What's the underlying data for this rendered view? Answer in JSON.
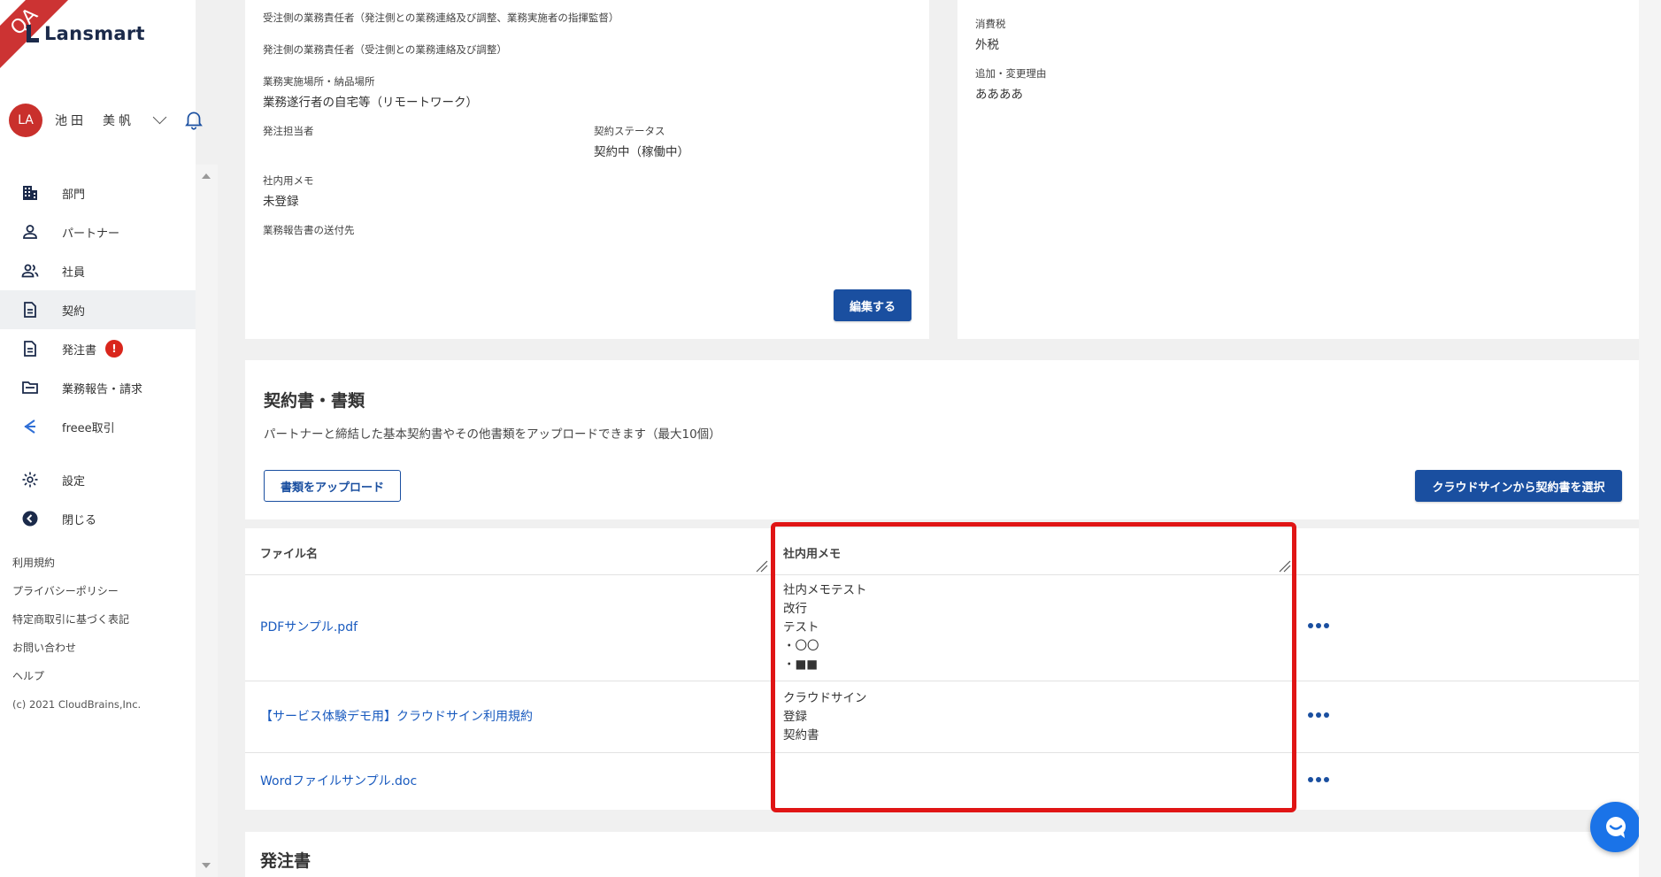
{
  "qa_ribbon": "QA",
  "brand": {
    "name": "Lansmart"
  },
  "user": {
    "initials": "LA",
    "name": "池田　美帆"
  },
  "nav": [
    {
      "label": "部門",
      "icon": "building-icon"
    },
    {
      "label": "パートナー",
      "icon": "person-icon"
    },
    {
      "label": "社員",
      "icon": "people-icon"
    },
    {
      "label": "契約",
      "icon": "document-icon",
      "active": true
    },
    {
      "label": "発注書",
      "icon": "document-icon",
      "badge": "!"
    },
    {
      "label": "業務報告・請求",
      "icon": "folder-icon"
    },
    {
      "label": "freee取引",
      "icon": "freee-icon"
    },
    {
      "label": "設定",
      "icon": "gear-icon"
    },
    {
      "label": "閉じる",
      "icon": "back-circle-icon"
    }
  ],
  "footer": {
    "links": [
      "利用規約",
      "プライバシーポリシー",
      "特定商取引に基づく表記",
      "お問い合わせ",
      "ヘルプ"
    ],
    "copyright": "(c) 2021 CloudBrains,Inc."
  },
  "contract_details": {
    "receiver_manager_label": "受注側の業務責任者（発注側との業務連絡及び調整、業務実施者の指揮監督）",
    "orderer_manager_label": "発注側の業務責任者（受注側との業務連絡及び調整）",
    "location_label": "業務実施場所・納品場所",
    "location_value": "業務遂行者の自宅等（リモートワーク）",
    "orderer_contact_label": "発注担当者",
    "status_label": "契約ステータス",
    "status_value": "契約中（稼働中）",
    "internal_memo_label": "社内用メモ",
    "internal_memo_value": "未登録",
    "report_dest_label": "業務報告書の送付先",
    "edit_button": "編集する"
  },
  "tax_card": {
    "tax_label": "消費税",
    "tax_value": "外税",
    "reason_label": "追加・変更理由",
    "reason_value": "ああああ"
  },
  "documents": {
    "title": "契約書・書類",
    "description": "パートナーと締結した基本契約書やその他書類をアップロードできます（最大10個）",
    "upload_button": "書類をアップロード",
    "cloudsign_button": "クラウドサインから契約書を選択",
    "columns": [
      "ファイル名",
      "社内用メモ"
    ],
    "rows": [
      {
        "file": "PDFサンプル.pdf",
        "memo": "社内メモテスト\n改行\nテスト\n・〇〇\n・■■"
      },
      {
        "file": "【サービス体験デモ用】クラウドサイン利用規約",
        "memo": "クラウドサイン\n登録\n契約書"
      },
      {
        "file": "Wordファイルサンプル.doc",
        "memo": ""
      }
    ]
  },
  "purchase_order": {
    "title": "発注書"
  },
  "colors": {
    "primary": "#1a4fa0",
    "link": "#1a5bbf",
    "highlight": "#e01515",
    "badge": "#d9261c"
  }
}
